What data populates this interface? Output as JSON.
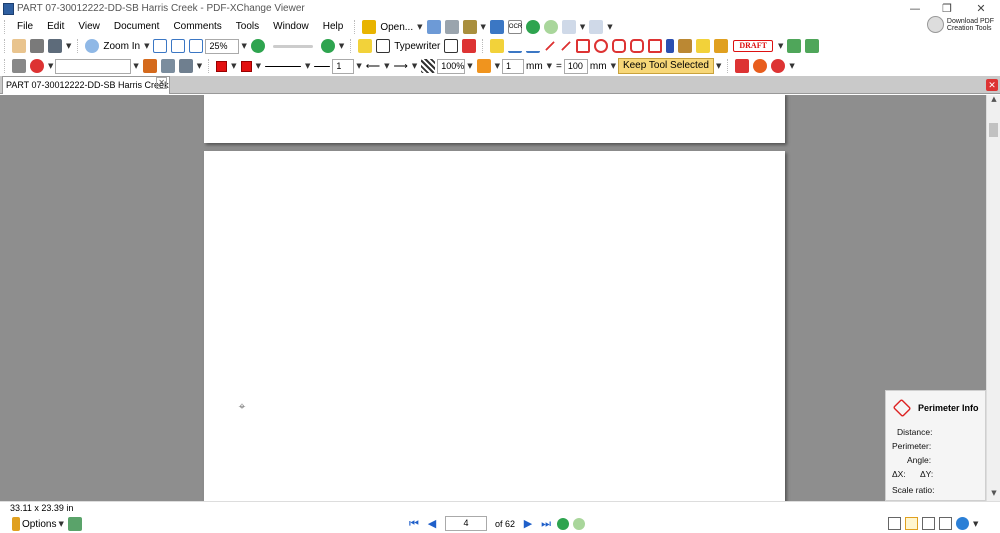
{
  "window": {
    "title": "PART 07-30012222-DD-SB Harris Creek - PDF-XChange Viewer",
    "minimize": "—",
    "restore": "❐",
    "close": "✕"
  },
  "menu": [
    "File",
    "Edit",
    "View",
    "Document",
    "Comments",
    "Tools",
    "Window",
    "Help"
  ],
  "toolbar1": {
    "open_label": "Open...",
    "ocr_label": "OCR",
    "download_pdf": "Download PDF",
    "creation_tools": "Creation Tools"
  },
  "toolbar2": {
    "zoom_in_label": "Zoom In",
    "zoom_value": "25%",
    "typewriter_label": "Typewriter",
    "draft_label": "DRAFT"
  },
  "toolbar3": {
    "line_width": "1",
    "opacity": "100%",
    "spacing_value": "1",
    "unit1": "mm",
    "equals": "=",
    "scale_value": "100",
    "unit2": "mm",
    "keep_tool_label": "Keep Tool Selected"
  },
  "tabs": [
    {
      "label": "PART 07-30012222-DD-SB Harris Creek"
    }
  ],
  "perimeter_info": {
    "title": "Perimeter Info",
    "distance": "Distance:",
    "perimeter": "Perimeter:",
    "angle": "Angle:",
    "dx": "ΔX:",
    "dy": "ΔY:",
    "scale_ratio": "Scale ratio:"
  },
  "status": {
    "page_size": "33.11 x 23.39 in"
  },
  "bottom": {
    "options_label": "Options",
    "current_page": "4",
    "total_pages": "of 62"
  },
  "colors": {
    "accent_blue": "#1f5fc9",
    "draft_red": "#dd1111",
    "keep_tool_bg": "#f7d778",
    "workspace_gray": "#8e8e8e"
  }
}
